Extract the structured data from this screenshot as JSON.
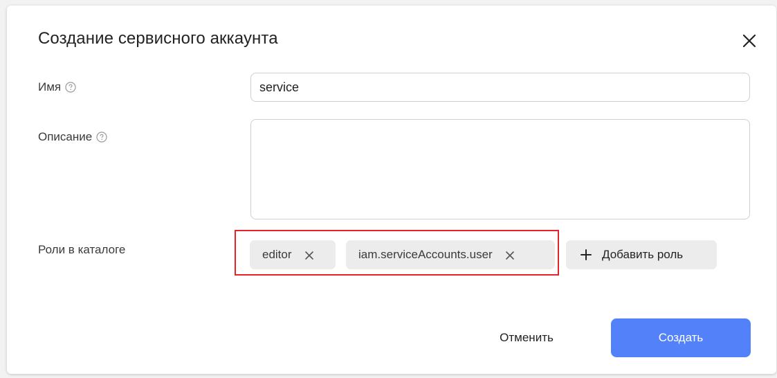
{
  "dialog": {
    "title": "Создание сервисного аккаунта",
    "close_icon": "close-icon"
  },
  "form": {
    "name": {
      "label": "Имя",
      "value": "service",
      "help_icon": "help-circle-icon"
    },
    "description": {
      "label": "Описание",
      "value": "",
      "help_icon": "help-circle-icon"
    },
    "roles": {
      "label": "Роли в каталоге",
      "items": [
        {
          "label": "editor"
        },
        {
          "label": "iam.serviceAccounts.user"
        }
      ],
      "add_label": "Добавить роль",
      "add_icon": "plus-icon",
      "remove_icon": "close-icon"
    }
  },
  "actions": {
    "cancel_label": "Отменить",
    "create_label": "Создать"
  },
  "colors": {
    "primary": "#5281fa",
    "highlight": "#e3222a",
    "chip_bg": "#ececec"
  }
}
